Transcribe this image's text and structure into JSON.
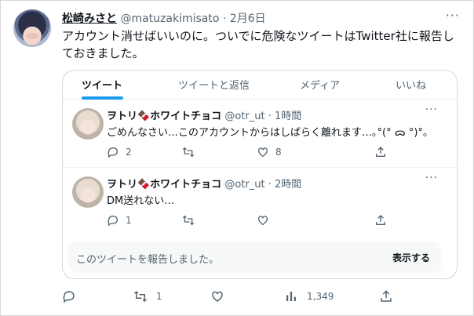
{
  "main_tweet": {
    "display_name": "松崎みさと",
    "handle": "@matuzakimisato",
    "separator": "·",
    "date": "2月6日",
    "more_glyph": "···",
    "text": "アカウント消せばいいのに。ついでに危険なツイートはTwitter社に報告しておきました。"
  },
  "card": {
    "tabs": [
      {
        "label": "ツイート",
        "active": true
      },
      {
        "label": "ツイートと返信",
        "active": false
      },
      {
        "label": "メディア",
        "active": false
      },
      {
        "label": "いいね",
        "active": false
      }
    ],
    "replies": [
      {
        "display_name": "ヲトリ🍫ホワイトチョコ",
        "handle": "@otr_ut",
        "separator": "·",
        "time": "1時間",
        "more_glyph": "···",
        "text": "ごめんなさい…このアカウントからはしばらく離れます…｡°(° ᯅ °)°｡",
        "reply_count": "2",
        "retweet_count": "",
        "like_count": "8"
      },
      {
        "display_name": "ヲトリ🍫ホワイトチョコ",
        "handle": "@otr_ut",
        "separator": "·",
        "time": "2時間",
        "more_glyph": "···",
        "text": "DM送れない…",
        "reply_count": "1",
        "retweet_count": "",
        "like_count": ""
      }
    ],
    "notice": {
      "text": "このツイートを報告しました。",
      "button": "表示する"
    }
  },
  "actions": {
    "reply_count": "",
    "retweet_count": "1",
    "like_count": "",
    "views_count": "1,349"
  },
  "colors": {
    "accent": "#1d9bf0",
    "muted": "#536471",
    "text": "#0f1419",
    "border": "#cfd9de"
  },
  "icons": [
    "reply-icon",
    "retweet-icon",
    "like-icon",
    "views-icon",
    "share-icon",
    "more-icon"
  ]
}
